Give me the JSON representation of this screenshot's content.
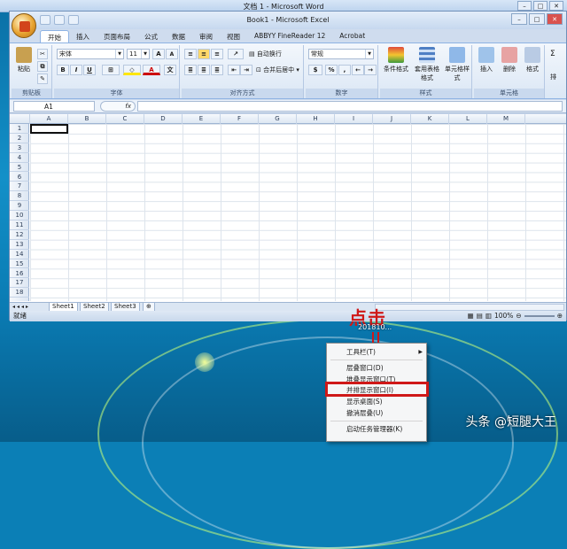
{
  "word_window": {
    "title": "文档 1 - Microsoft Word"
  },
  "excel": {
    "title": "Book1 - Microsoft Excel",
    "tabs": [
      "开始",
      "插入",
      "页面布局",
      "公式",
      "数据",
      "审阅",
      "视图",
      "ABBYY FineReader 12",
      "Acrobat"
    ],
    "ribbon": {
      "paste": "粘贴",
      "clipboard_label": "剪贴板",
      "font_name": "宋体",
      "font_size": "11",
      "bold": "B",
      "italic": "I",
      "underline": "U",
      "font_label": "字体",
      "wrap_text": "自动换行",
      "merge_center": "合并后居中",
      "alignment_label": "对齐方式",
      "number_format": "常规",
      "percent": "%",
      "comma": ",",
      "number_label": "数字",
      "conditional_format": "条件格式",
      "table_format": "套用表格格式",
      "cell_style": "单元格样式",
      "styles_label": "样式",
      "insert": "插入",
      "delete": "删除",
      "format": "格式",
      "cells_label": "单元格",
      "sigma": "Σ",
      "sort": "排"
    },
    "name_box": "A1",
    "fx": "fx",
    "columns": [
      "A",
      "B",
      "C",
      "D",
      "E",
      "F",
      "G",
      "H",
      "I",
      "J",
      "K",
      "L",
      "M"
    ],
    "rows": [
      "1",
      "2",
      "3",
      "4",
      "5",
      "6",
      "7",
      "8",
      "9",
      "10",
      "11",
      "12",
      "13",
      "14",
      "15",
      "16",
      "17",
      "18"
    ],
    "sheets": [
      "Sheet1",
      "Sheet2",
      "Sheet3"
    ],
    "status": "就绪",
    "zoom": "100%"
  },
  "annotation": "点击",
  "taskbar_item": "201810...",
  "context_menu": {
    "items": [
      {
        "label": "工具栏(T)"
      },
      {
        "label": "层叠窗口(D)"
      },
      {
        "label": "堆叠显示窗口(T)"
      },
      {
        "label": "并排显示窗口(I)"
      },
      {
        "label": "显示桌面(S)"
      },
      {
        "label": "撤消层叠(U)"
      },
      {
        "label": "启动任务管理器(K)"
      }
    ],
    "highlighted_item": "并排显示窗口(I)"
  },
  "watermark": "头条 @短腿大王",
  "colors": {
    "highlight_red": "#cf1818",
    "ribbon_blue": "#dbe7f5",
    "desktop_blue": "#0b7fb6"
  }
}
